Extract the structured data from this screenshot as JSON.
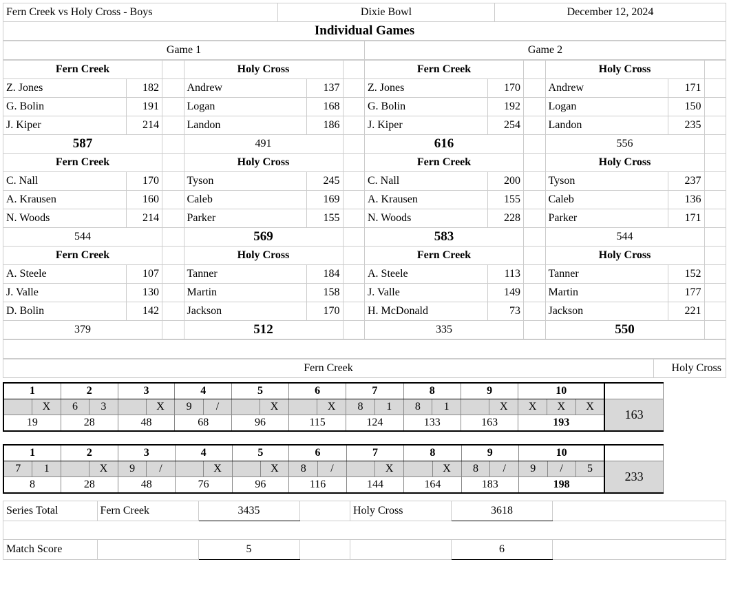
{
  "meta": {
    "matchup": "Fern Creek vs Holy Cross - Boys",
    "venue": "Dixie Bowl",
    "date": "December 12, 2024",
    "section_title": "Individual Games",
    "game1_label": "Game 1",
    "game2_label": "Game 2"
  },
  "teams": {
    "a": "Fern Creek",
    "b": "Holy Cross"
  },
  "individual": {
    "game1": {
      "groups": [
        {
          "a": {
            "players": [
              [
                "Z. Jones",
                "182"
              ],
              [
                "G. Bolin",
                "191"
              ],
              [
                "J. Kiper",
                "214"
              ]
            ],
            "total": "587",
            "win": true
          },
          "b": {
            "players": [
              [
                "Andrew",
                "137"
              ],
              [
                "Logan",
                "168"
              ],
              [
                "Landon",
                "186"
              ]
            ],
            "total": "491",
            "win": false
          }
        },
        {
          "a": {
            "players": [
              [
                "C. Nall",
                "170"
              ],
              [
                "A. Krausen",
                "160"
              ],
              [
                "N. Woods",
                "214"
              ]
            ],
            "total": "544",
            "win": false
          },
          "b": {
            "players": [
              [
                "Tyson",
                "245"
              ],
              [
                "Caleb",
                "169"
              ],
              [
                "Parker",
                "155"
              ]
            ],
            "total": "569",
            "win": true
          }
        },
        {
          "a": {
            "players": [
              [
                "A. Steele",
                "107"
              ],
              [
                "J. Valle",
                "130"
              ],
              [
                "D. Bolin",
                "142"
              ]
            ],
            "total": "379",
            "win": false
          },
          "b": {
            "players": [
              [
                "Tanner",
                "184"
              ],
              [
                "Martin",
                "158"
              ],
              [
                "Jackson",
                "170"
              ]
            ],
            "total": "512",
            "win": true
          }
        }
      ]
    },
    "game2": {
      "groups": [
        {
          "a": {
            "players": [
              [
                "Z. Jones",
                "170"
              ],
              [
                "G. Bolin",
                "192"
              ],
              [
                "J. Kiper",
                "254"
              ]
            ],
            "total": "616",
            "win": true
          },
          "b": {
            "players": [
              [
                "Andrew",
                "171"
              ],
              [
                "Logan",
                "150"
              ],
              [
                "Landon",
                "235"
              ]
            ],
            "total": "556",
            "win": false
          }
        },
        {
          "a": {
            "players": [
              [
                "C. Nall",
                "200"
              ],
              [
                "A. Krausen",
                "155"
              ],
              [
                "N. Woods",
                "228"
              ]
            ],
            "total": "583",
            "win": true
          },
          "b": {
            "players": [
              [
                "Tyson",
                "237"
              ],
              [
                "Caleb",
                "136"
              ],
              [
                "Parker",
                "171"
              ]
            ],
            "total": "544",
            "win": false
          }
        },
        {
          "a": {
            "players": [
              [
                "A. Steele",
                "113"
              ],
              [
                "J. Valle",
                "149"
              ],
              [
                "H. McDonald",
                "73"
              ]
            ],
            "total": "335",
            "win": false
          },
          "b": {
            "players": [
              [
                "Tanner",
                "152"
              ],
              [
                "Martin",
                "177"
              ],
              [
                "Jackson",
                "221"
              ]
            ],
            "total": "550",
            "win": true
          }
        }
      ]
    }
  },
  "baker_labels": {
    "a": "Fern Creek",
    "b": "Holy Cross"
  },
  "frame_headers": [
    "1",
    "2",
    "3",
    "4",
    "5",
    "6",
    "7",
    "8",
    "9",
    "10"
  ],
  "scorecards": [
    {
      "balls": [
        "",
        "X",
        "6",
        "3",
        "",
        "X",
        "9",
        "/",
        "",
        "X",
        "",
        "X",
        "8",
        "1",
        "8",
        "1",
        "",
        "X",
        "X",
        "X",
        "X"
      ],
      "cumulative": [
        "19",
        "28",
        "48",
        "68",
        "96",
        "115",
        "124",
        "133",
        "163",
        "193"
      ],
      "side": "163"
    },
    {
      "balls": [
        "7",
        "1",
        "",
        "X",
        "9",
        "/",
        "",
        "X",
        "",
        "X",
        "8",
        "/",
        "",
        "X",
        "",
        "X",
        "8",
        "/",
        "9",
        "/",
        "5"
      ],
      "cumulative": [
        "8",
        "28",
        "48",
        "76",
        "96",
        "116",
        "144",
        "164",
        "183",
        "198"
      ],
      "side": "233"
    }
  ],
  "summary": {
    "series_label": "Series Total",
    "match_label": "Match Score",
    "team_a": "Fern Creek",
    "team_b": "Holy Cross",
    "series_a": "3435",
    "series_b": "3618",
    "match_a": "5",
    "match_b": "6"
  }
}
